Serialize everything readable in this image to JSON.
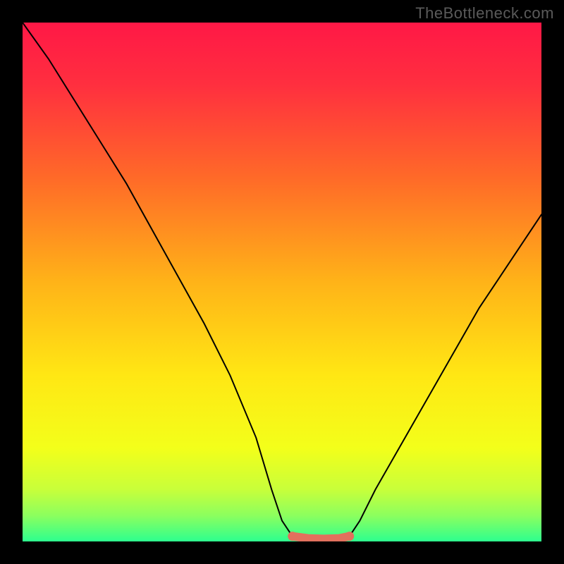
{
  "watermark": "TheBottleneck.com",
  "chart_data": {
    "type": "line",
    "title": "",
    "xlabel": "",
    "ylabel": "",
    "xlim": [
      0,
      100
    ],
    "ylim": [
      0,
      100
    ],
    "grid": false,
    "legend": false,
    "series": [
      {
        "name": "curve-left",
        "x": [
          0,
          5,
          10,
          15,
          20,
          25,
          30,
          35,
          40,
          45,
          48,
          50,
          52
        ],
        "values": [
          100,
          93,
          85,
          77,
          69,
          60,
          51,
          42,
          32,
          20,
          10,
          4,
          1
        ]
      },
      {
        "name": "curve-right",
        "x": [
          63,
          65,
          68,
          72,
          76,
          80,
          84,
          88,
          92,
          96,
          100
        ],
        "values": [
          1,
          4,
          10,
          17,
          24,
          31,
          38,
          45,
          51,
          57,
          63
        ]
      },
      {
        "name": "highlight-band",
        "x": [
          52,
          55,
          58,
          61,
          63
        ],
        "values": [
          1,
          0.6,
          0.5,
          0.6,
          1
        ]
      }
    ],
    "background_gradient": {
      "stops": [
        {
          "offset": 0.0,
          "color": "#ff1846"
        },
        {
          "offset": 0.12,
          "color": "#ff2f3f"
        },
        {
          "offset": 0.3,
          "color": "#ff6a28"
        },
        {
          "offset": 0.5,
          "color": "#ffb318"
        },
        {
          "offset": 0.68,
          "color": "#ffe714"
        },
        {
          "offset": 0.82,
          "color": "#f3ff1a"
        },
        {
          "offset": 0.9,
          "color": "#c8ff3a"
        },
        {
          "offset": 0.95,
          "color": "#8cff5e"
        },
        {
          "offset": 1.0,
          "color": "#2dff8f"
        }
      ]
    },
    "highlight_color": "#e2705d"
  }
}
